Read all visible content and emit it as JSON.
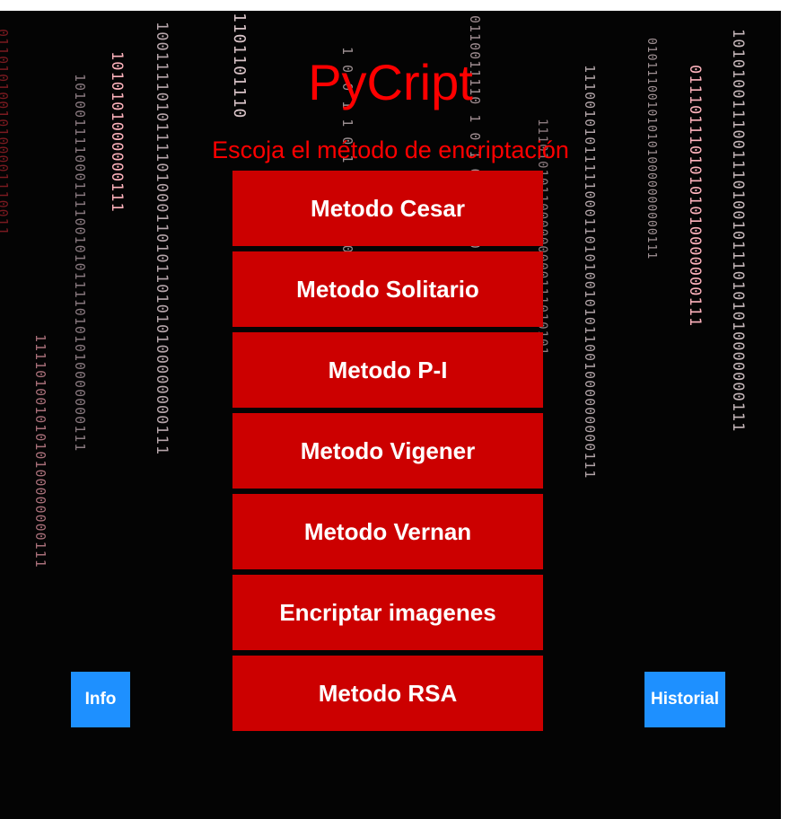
{
  "app": {
    "title": "PyCript",
    "subtitle": "Escoja el método de encriptación"
  },
  "methods": [
    {
      "label": "Metodo Cesar"
    },
    {
      "label": "Metodo Solitario"
    },
    {
      "label": "Metodo P-I"
    },
    {
      "label": "Metodo Vigener"
    },
    {
      "label": "Metodo Vernan"
    },
    {
      "label": "Encriptar imagenes"
    },
    {
      "label": "Metodo RSA"
    }
  ],
  "buttons": {
    "info_label": "Info",
    "historial_label": "Historial"
  },
  "colors": {
    "background": "#040404",
    "title": "#ff0000",
    "method_button": "#cc0000",
    "side_button": "#1e90ff",
    "button_text": "#ffffff"
  }
}
